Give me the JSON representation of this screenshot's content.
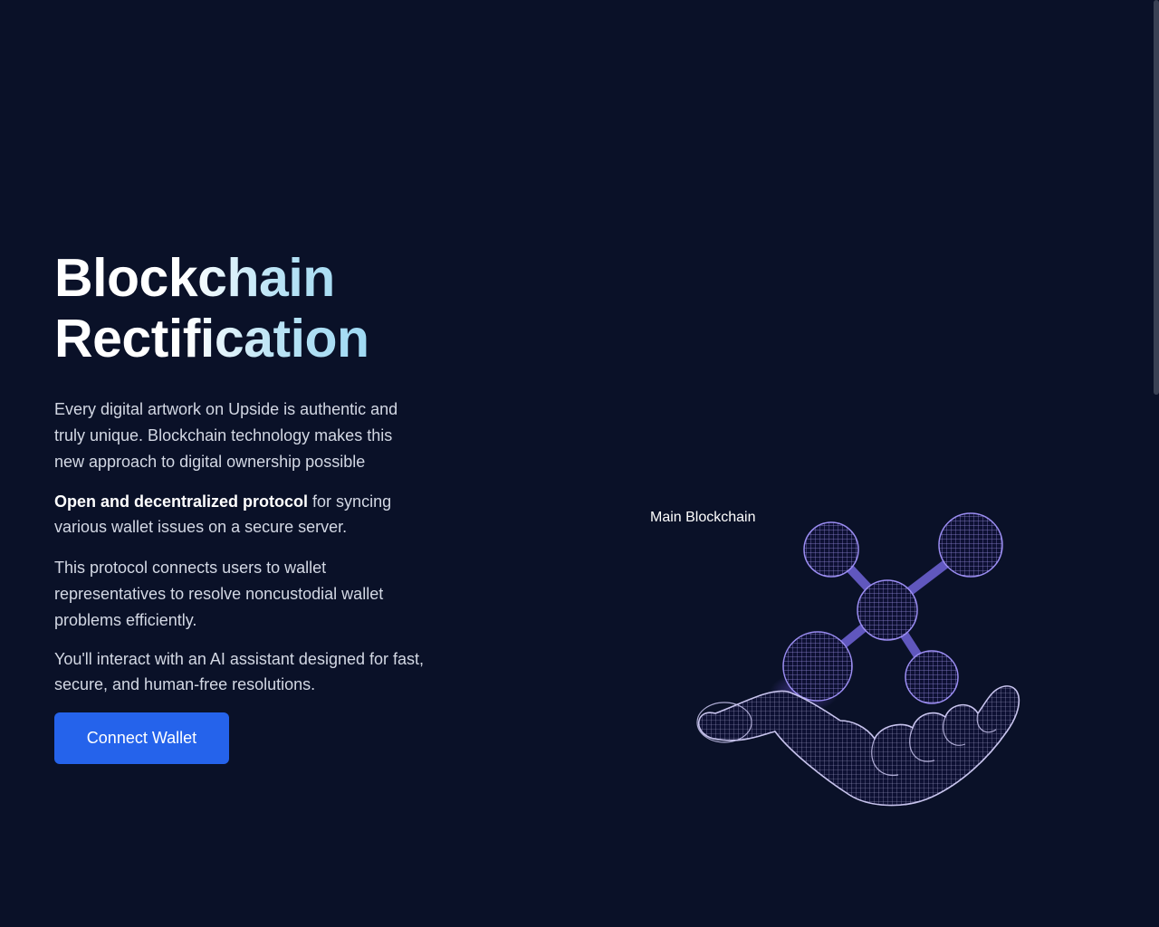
{
  "hero": {
    "title_line1": "Blockchain",
    "title_line2": "Rectification",
    "paragraph1": "Every digital artwork on Upside is authentic and truly unique. Blockchain technology makes this new approach to digital ownership possible",
    "paragraph2_bold": "Open and decentralized protocol",
    "paragraph2_rest": " for syncing various wallet issues on a secure server.",
    "paragraph3": "This protocol connects users to wallet representatives to resolve noncustodial wallet problems efficiently.",
    "paragraph4": "You'll interact with an AI assistant designed for fast, secure, and human-free resolutions.",
    "cta_label": "Connect Wallet"
  },
  "illustration": {
    "label": "Main Blockchain",
    "icon": "hand-holding-molecule-icon"
  },
  "colors": {
    "background": "#0a1128",
    "accent_button": "#2563eb",
    "wireframe": "#8b7cf0",
    "title_gradient_end": "#8fd3f2"
  }
}
